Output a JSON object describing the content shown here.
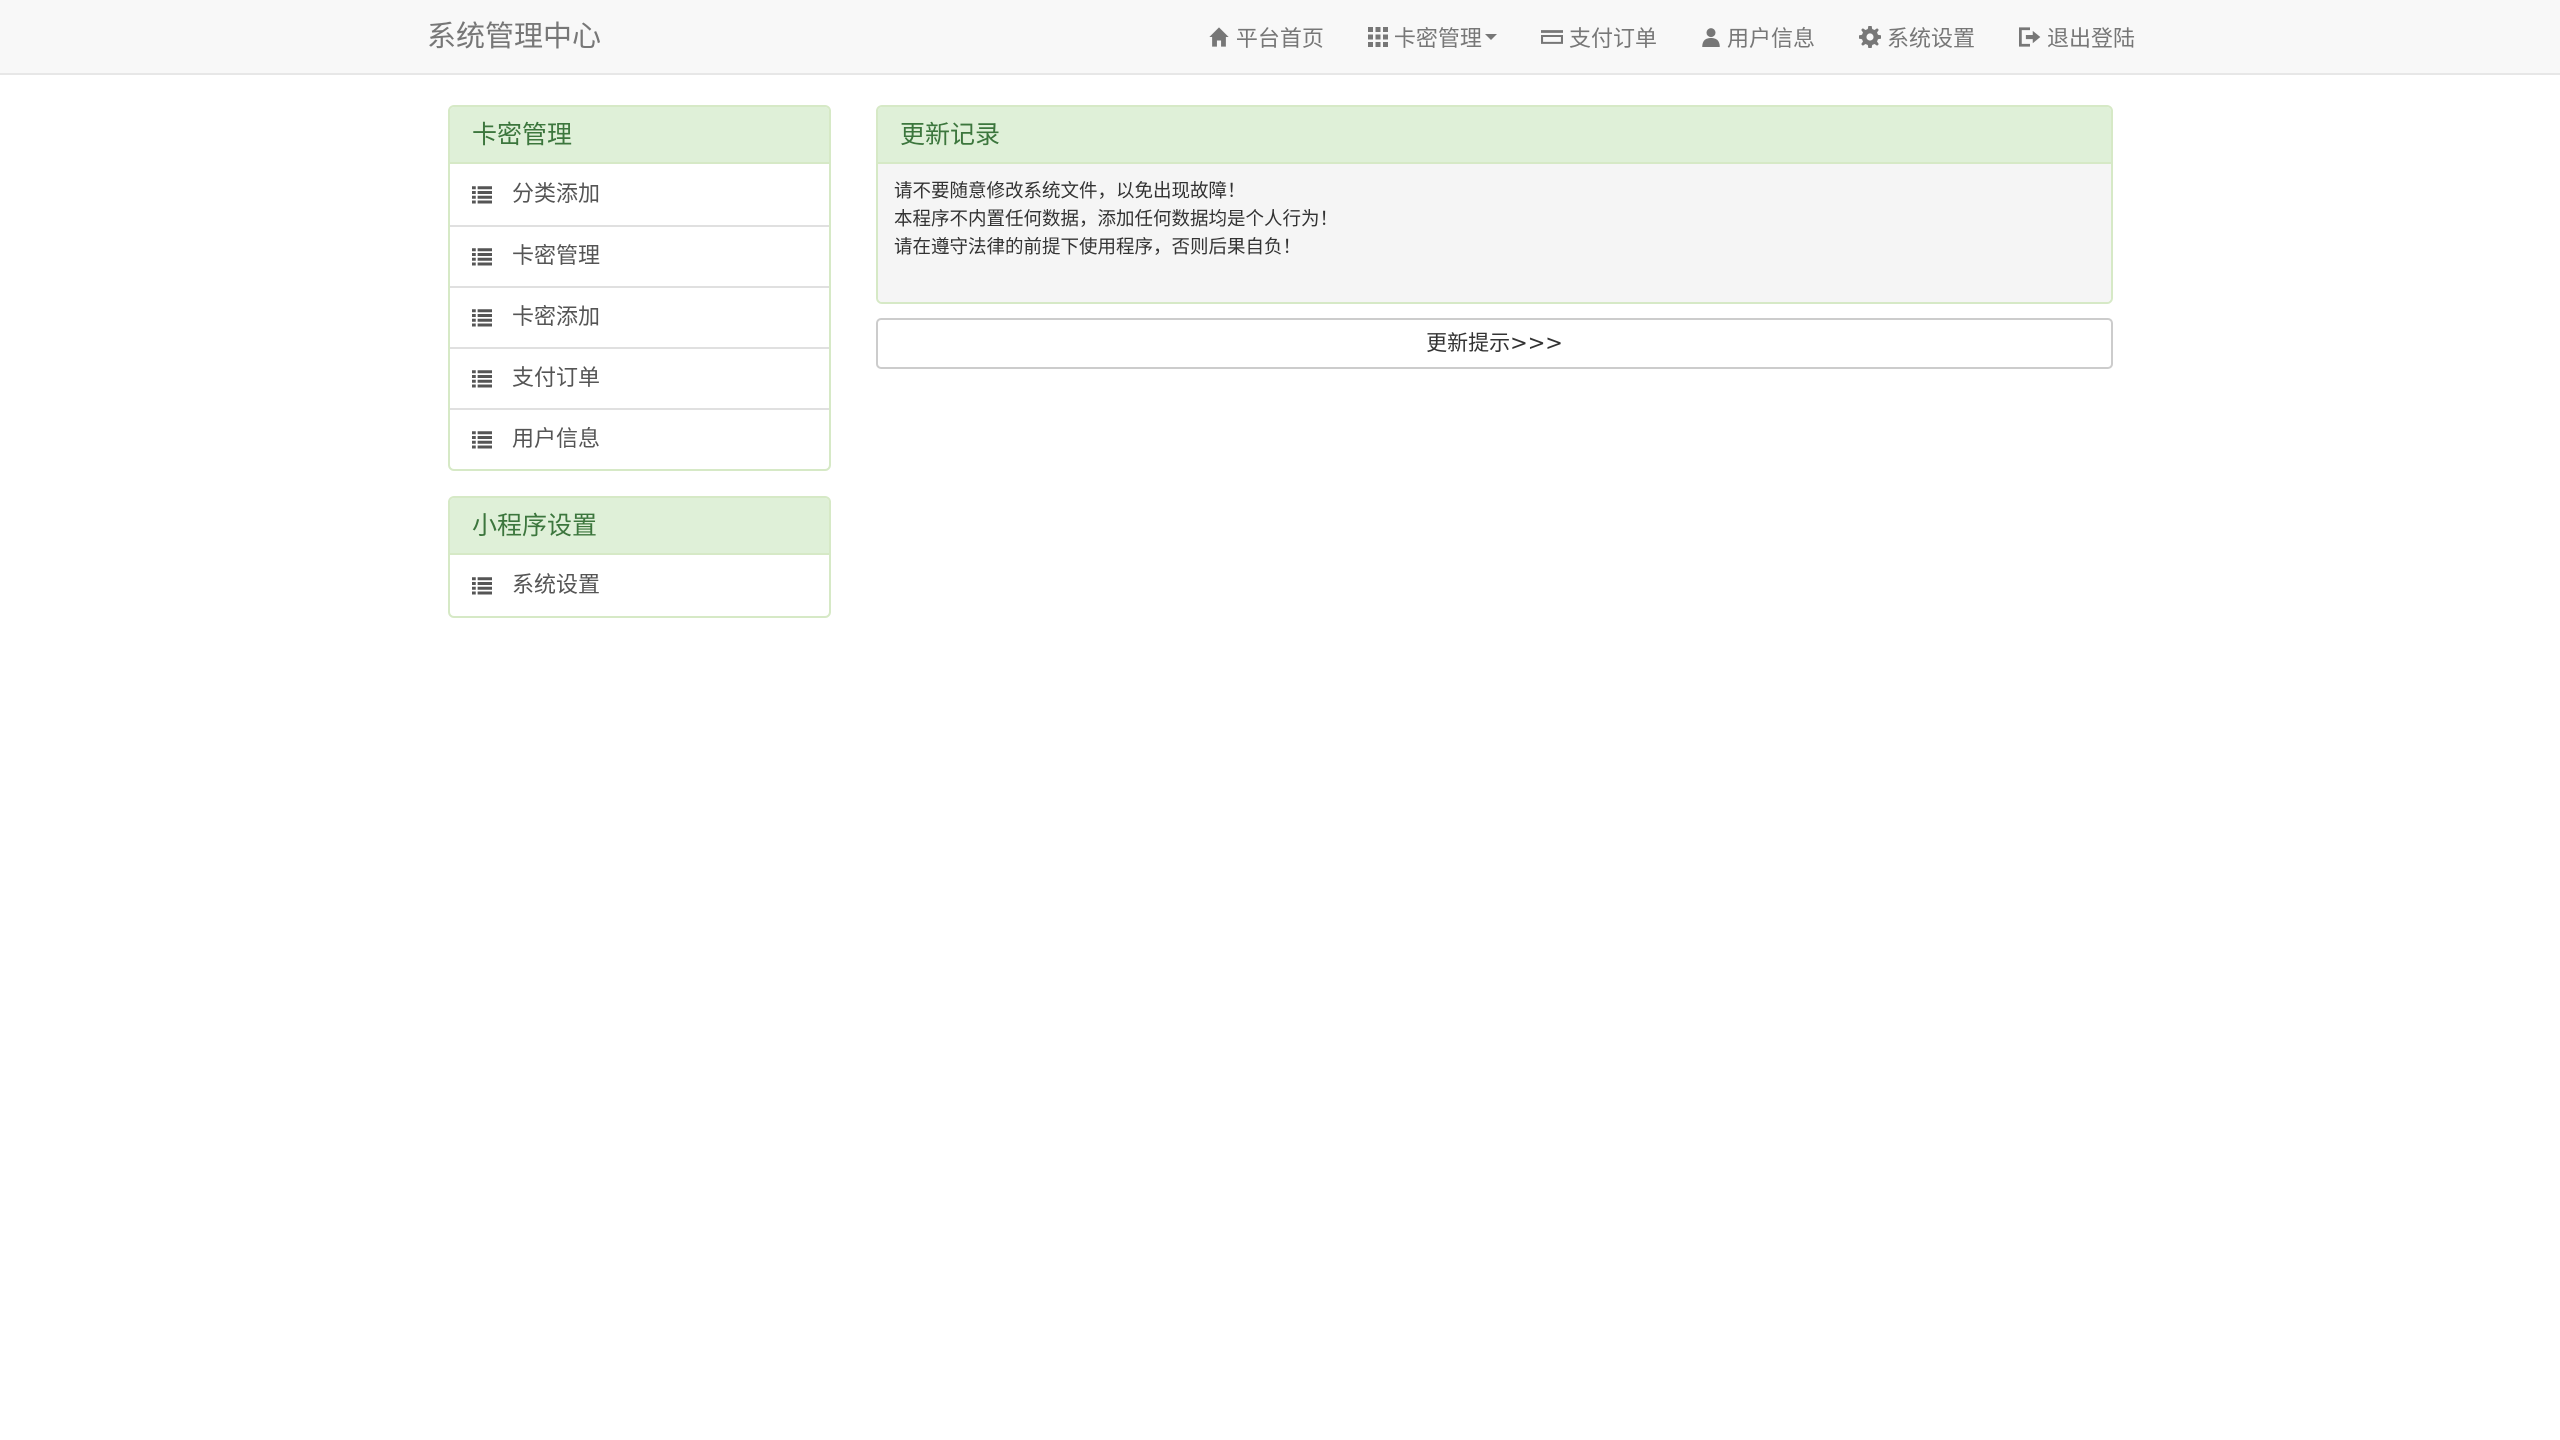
{
  "navbar": {
    "brand": "系统管理中心",
    "items": [
      {
        "label": "平台首页",
        "icon": "home-icon"
      },
      {
        "label": "卡密管理",
        "icon": "th-grid-icon",
        "dropdown": true
      },
      {
        "label": "支付订单",
        "icon": "credit-card-icon"
      },
      {
        "label": "用户信息",
        "icon": "user-icon"
      },
      {
        "label": "系统设置",
        "icon": "gear-icon"
      },
      {
        "label": "退出登陆",
        "icon": "log-out-icon"
      }
    ]
  },
  "sidebar": {
    "cards_panel": {
      "title": "卡密管理",
      "items": [
        {
          "label": "分类添加",
          "icon": "list-icon"
        },
        {
          "label": "卡密管理",
          "icon": "list-icon"
        },
        {
          "label": "卡密添加",
          "icon": "list-icon"
        },
        {
          "label": "支付订单",
          "icon": "list-icon"
        },
        {
          "label": "用户信息",
          "icon": "list-icon"
        }
      ]
    },
    "mini_panel": {
      "title": "小程序设置",
      "items": [
        {
          "label": "系统设置",
          "icon": "list-icon"
        }
      ]
    }
  },
  "main": {
    "updates_panel": {
      "title": "更新记录",
      "lines": [
        "请不要随意修改系统文件，以免出现故障！",
        "本程序不内置任何数据，添加任何数据均是个人行为！",
        "请在遵守法律的前提下使用程序，否则后果自负！"
      ]
    },
    "update_button_label": "更新提示>>>"
  },
  "colors": {
    "navbar_bg": "#f8f8f8",
    "panel_heading_bg": "#dff0d8",
    "panel_heading_text": "#3c763d",
    "panel_border": "#d6e9c6"
  }
}
